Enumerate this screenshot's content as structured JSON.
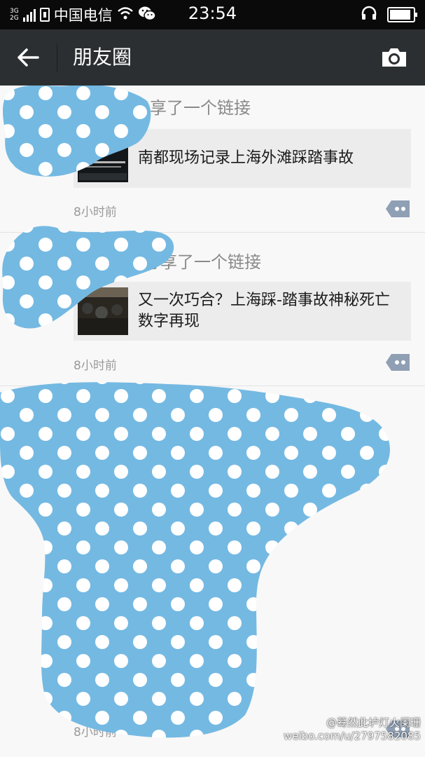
{
  "status_bar": {
    "network_type_top": "3G",
    "network_type_bottom": "2G",
    "carrier": "中国电信",
    "time": "23:54",
    "battery_level": 0.9
  },
  "title_bar": {
    "title": "朋友圈",
    "back_icon": "arrow-left-icon",
    "camera_icon": "camera-icon"
  },
  "posts": [
    {
      "shared_text": "分享了一个链接",
      "link_title": "南都现场记录上海外滩踩踏事故",
      "time": "8小时前"
    },
    {
      "shared_text": "分享了一个链接",
      "link_title": "又一次巧合？上海踩-踏事故神秘死亡数字再现",
      "time": "8小时前"
    },
    {
      "shared_text": "",
      "link_title": "",
      "time": "8小时前"
    }
  ],
  "watermark": {
    "line1": "@蓦然此垆灯火阑珊",
    "line2": "weibo.com/u/2797582085"
  },
  "colors": {
    "titlebar": "#2b2f31",
    "statusbar": "#0a0a0a",
    "mask_blue": "#74b9e2",
    "comment_button": "#8f9fb4"
  }
}
